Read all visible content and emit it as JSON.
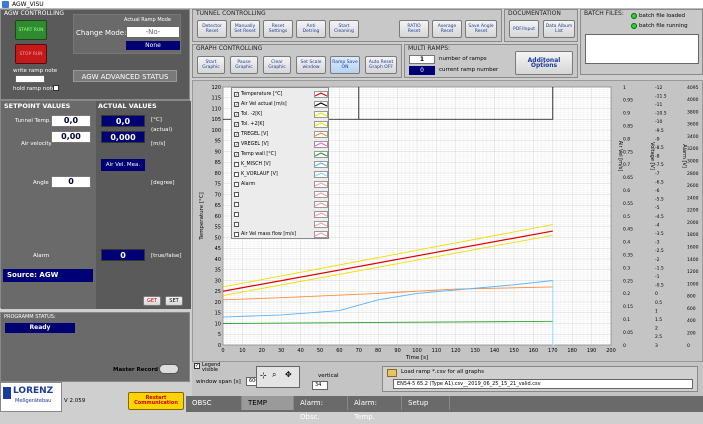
{
  "window": {
    "title": "AGW_VISU"
  },
  "agw_controlling": {
    "header": "AGW CONTROLLING",
    "start_label": "START RUN",
    "stop_label": "STOP RUN",
    "actual_ramp_mode_label": "Actual Ramp Mode",
    "change_mode_label": "Change Mode:",
    "mode_value": "-No-",
    "mode_actual": "None",
    "write_ramp_note": "write ramp note",
    "hold_ramp_note": "hold ramp note?",
    "advanced_status": "AGW ADVANCED STATUS"
  },
  "tunnel_controlling": {
    "header": "TUNNEL CONTROLLING",
    "buttons": [
      "Detector Reset",
      "Manually Set Reset",
      "Reset Settings",
      "Anti Detring",
      "Start Cleaning"
    ],
    "buttons2": [
      "RATIO Reset",
      "Average Reset",
      "Save Angle Reset"
    ]
  },
  "documentation": {
    "header": "DOCUMENTATION",
    "buttons": [
      "PDF/Input",
      "Data Album List"
    ]
  },
  "batch_files": {
    "header": "BATCH FILES:",
    "status": [
      "batch file loaded",
      "batch file running"
    ]
  },
  "graph_controlling": {
    "header": "GRAPH CONTROLLING",
    "buttons": [
      "Start Graphic",
      "Pause Graphic",
      "Clear Graphic",
      "Set Scale window",
      "Ramp Save ON",
      "Auto Reset Graph OFF"
    ]
  },
  "multi_ramps": {
    "header": "MULTI RAMPS:",
    "number_of_ramps_label": "number of ramps",
    "number_of_ramps": "1",
    "current_ramp_label": "current ramp number",
    "current_ramp": "0",
    "options_label": "Additonal Options"
  },
  "setpoint": {
    "header": "SETPOINT VALUES",
    "tunnel_temp_label": "Tunnel Temp.",
    "tunnel_temp": "0,0",
    "air_velocity_label": "Air velocity",
    "air_velocity": "0,00",
    "angle_label": "Angle",
    "angle": "0",
    "alarm_label": "Alarm"
  },
  "actual": {
    "header": "ACTUAL VALUES",
    "temp": "0,0",
    "temp_unit": "[°C]",
    "actual_label": "(actual)",
    "air": "0,000",
    "air_unit": "[m/s]",
    "air_vel_button": "Air Vel. Mea.",
    "degree_unit": "[degree]",
    "alarm": "0",
    "alarm_unit": "[true/false]"
  },
  "source": {
    "label": "Source: AGW",
    "get": "GET",
    "set": "SET"
  },
  "programm_status": {
    "header": "PROGRAMM STATUS:",
    "value": "Ready"
  },
  "master_record": "Master Record",
  "logo": {
    "name": "LORENZ",
    "sub": "Meßgerätebau",
    "version": "V 2.059"
  },
  "restart": "Restart Communication",
  "tabs": [
    "OBSC",
    "TEMP",
    "Alarm: Obsc.",
    "Alarm: Temp.",
    "Setup"
  ],
  "bottom": {
    "legend_visible": "Legend visible",
    "window_span": "window span [s]",
    "window_span_value": "600",
    "vertical": "vertical",
    "vertical_value": "34",
    "load_ramp_label": "Load ramp *.csv for all graphs",
    "file_path": "EN54-5 65.2 (Type A1).csv__2019_06_25_15_21_valid.csv"
  },
  "legend": [
    {
      "label": "Temperature [°C]",
      "color": "#e00000",
      "checked": true
    },
    {
      "label": "Air Vel actual [m/s]",
      "color": "#000000",
      "checked": true
    },
    {
      "label": "Tol. -2[K]",
      "color": "#e8e800",
      "checked": true
    },
    {
      "label": "Tol. +2[K]",
      "color": "#e8e800",
      "checked": true
    },
    {
      "label": "TREGEL [V]",
      "color": "#ff8c3c",
      "checked": true
    },
    {
      "label": "VREGEL [V]",
      "color": "#ff66cc",
      "checked": true
    },
    {
      "label": "Temp wall [°C]",
      "color": "#29a329",
      "checked": true
    },
    {
      "label": "K_MISCH [V]",
      "color": "#5ab4ff",
      "checked": false
    },
    {
      "label": "K_VORLAUF [V]",
      "color": "#8ad4ff",
      "checked": false
    },
    {
      "label": "Alarm",
      "color": "#ff9e9e",
      "checked": false
    },
    {
      "label": "",
      "color": "#ff9e9e",
      "checked": false
    },
    {
      "label": "",
      "color": "#ff9e9e",
      "checked": false
    },
    {
      "label": "",
      "color": "#ff9e9e",
      "checked": false
    },
    {
      "label": "",
      "color": "#ff9e9e",
      "checked": false
    },
    {
      "label": "Air Vel mass flow [m/s]",
      "color": "#ff9e9e",
      "checked": false
    }
  ],
  "chart_data": {
    "type": "line",
    "xlabel": "Time [s]",
    "ylabel": "Temperature [°C]",
    "xlim": [
      0,
      200
    ],
    "ylim": [
      0,
      120
    ],
    "x_ticks": [
      0,
      10,
      20,
      30,
      40,
      50,
      60,
      70,
      80,
      90,
      100,
      110,
      120,
      130,
      140,
      150,
      160,
      170,
      180,
      190,
      200
    ],
    "y_ticks": [
      0,
      5,
      10,
      15,
      20,
      25,
      30,
      35,
      40,
      45,
      50,
      55,
      60,
      65,
      70,
      75,
      80,
      85,
      90,
      95,
      100,
      105,
      110,
      115,
      120
    ],
    "right_axes": [
      {
        "label": "Air Vel [m/s]",
        "ticks": [
          "1",
          "0.95",
          "0.9",
          "0.85",
          "0.8",
          "0.75",
          "0.7",
          "0.65",
          "0.6",
          "0.55",
          "0.5",
          "0.45",
          "0.4",
          "0.35",
          "0.3",
          "0.25",
          "0.2",
          "0.15",
          "0.1",
          "0.05",
          "0"
        ]
      },
      {
        "label": "Voltage [V]",
        "ticks": [
          "-12",
          "-11.5",
          "-11",
          "-10.5",
          "-10",
          "-9.5",
          "-9",
          "-8.5",
          "-8",
          "-7.5",
          "-7",
          "-6.5",
          "-6",
          "-5.5",
          "-5",
          "-4.5",
          "-4",
          "-3.5",
          "-3",
          "-2.5",
          "-2",
          "-1.5",
          "-1",
          "-0.5",
          "0",
          "0.5",
          "1",
          "1.5",
          "2",
          "2.5",
          "3"
        ]
      },
      {
        "label": "Alarm [V]",
        "ticks": [
          "4095",
          "4000",
          "3800",
          "3600",
          "3400",
          "3200",
          "3000",
          "2800",
          "2600",
          "2400",
          "2200",
          "2000",
          "1800",
          "1600",
          "1400",
          "1200",
          "1000",
          "800",
          "600",
          "400",
          "200",
          "0"
        ]
      }
    ],
    "series": [
      {
        "name": "Tol. +2[K]",
        "color": "#f0e000",
        "x": [
          0,
          170
        ],
        "y": [
          27,
          56
        ]
      },
      {
        "name": "Temperature [°C]",
        "color": "#e00000",
        "x": [
          0,
          170
        ],
        "y": [
          25,
          53
        ]
      },
      {
        "name": "Tol. -2[K]",
        "color": "#f0e000",
        "x": [
          0,
          170
        ],
        "y": [
          23,
          51
        ]
      },
      {
        "name": "TREGEL [V]",
        "color": "#ff8c3c",
        "x": [
          0,
          30,
          80,
          120,
          170
        ],
        "y": [
          21,
          22,
          24,
          26,
          27
        ]
      },
      {
        "name": "K_MISCH [V]",
        "color": "#5ab4ff",
        "x": [
          0,
          30,
          60,
          80,
          100,
          150,
          170
        ],
        "y": [
          13,
          14,
          16,
          21,
          24,
          28,
          30
        ]
      },
      {
        "name": "Temp wall [°C]",
        "color": "#29a329",
        "x": [
          0,
          170
        ],
        "y": [
          10,
          11
        ]
      },
      {
        "name": "K_VORLAUF [V]",
        "color": "#8ad4ff",
        "x": [
          170,
          170,
          171
        ],
        "y": [
          30,
          0,
          0
        ]
      }
    ]
  }
}
